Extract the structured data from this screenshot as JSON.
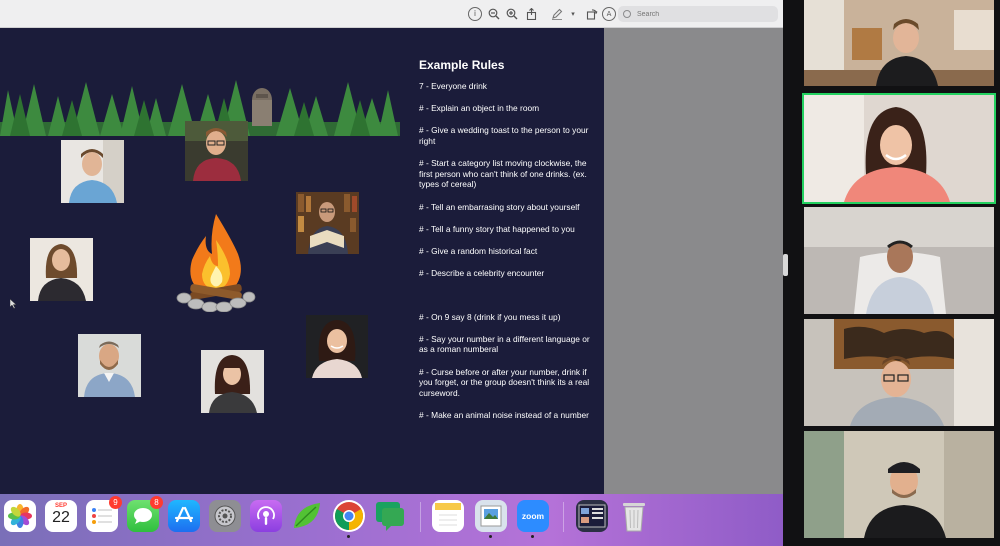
{
  "toolbar": {
    "search_placeholder": "Search",
    "icons": [
      "info-icon",
      "zoom-out-icon",
      "zoom-in-icon",
      "share-icon",
      "markup-icon",
      "chevron-down-icon",
      "rotate-icon",
      "annotate-icon"
    ]
  },
  "slide": {
    "title": "Example Rules",
    "rules": [
      "7 - Everyone drink",
      "# - Explain an object in the room",
      "# - Give a wedding toast to the person to your right",
      "# - Start a category list moving clockwise, the first person who can't think of one drinks.  (ex. types of cereal)",
      "# - Tell an embarrasing story about yourself",
      "# - Tell a funny story that happened to you",
      "# - Give a random historical fact",
      "# - Describe a celebrity encounter",
      "# - On 9 say 8 (drink if you mess it up)",
      "# - Say your number in a different language or as a roman numberal",
      "# - Curse before or after your number, drink if you forget, or the group doesn't think its a real curseword.",
      "# - Make an animal noise instead of a number"
    ]
  },
  "dock": {
    "calendar_month": "SEP",
    "calendar_day": "22",
    "reminders_badge": "9",
    "messages_badge": "8",
    "zoom_label": "zoom"
  },
  "colors": {
    "slide_bg": "#1b1c3a",
    "active_speaker": "#23d160",
    "badge": "#ff3b30"
  }
}
